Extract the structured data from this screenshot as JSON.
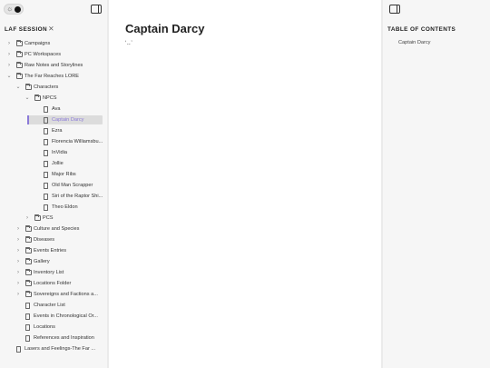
{
  "sidebar": {
    "section_title": "LAF SESSION",
    "tree": [
      {
        "label": "Campaigns",
        "type": "folder",
        "depth": 0,
        "expanded": false
      },
      {
        "label": "PC Workspaces",
        "type": "folder",
        "depth": 0,
        "expanded": false
      },
      {
        "label": "Raw Notes and Storylines",
        "type": "folder",
        "depth": 0,
        "expanded": false
      },
      {
        "label": "The Far Reaches LORE",
        "type": "folder",
        "depth": 0,
        "expanded": true
      },
      {
        "label": "Characters",
        "type": "folder",
        "depth": 1,
        "expanded": true
      },
      {
        "label": "NPCS",
        "type": "folder",
        "depth": 2,
        "expanded": true
      },
      {
        "label": "Ava",
        "type": "file",
        "depth": 3
      },
      {
        "label": "Captain Darcy",
        "type": "file",
        "depth": 3,
        "active": true
      },
      {
        "label": "Ezra",
        "type": "file",
        "depth": 3
      },
      {
        "label": "Florencia Williamsbu...",
        "type": "file",
        "depth": 3
      },
      {
        "label": "InVidia",
        "type": "file",
        "depth": 3
      },
      {
        "label": "Jollie",
        "type": "file",
        "depth": 3
      },
      {
        "label": "Major Ribs",
        "type": "file",
        "depth": 3
      },
      {
        "label": "Old Man Scrapper",
        "type": "file",
        "depth": 3
      },
      {
        "label": "Siri of the Raptor Shi...",
        "type": "file",
        "depth": 3
      },
      {
        "label": "Theo Eldon",
        "type": "file",
        "depth": 3
      },
      {
        "label": "PCS",
        "type": "folder",
        "depth": 2,
        "expanded": false
      },
      {
        "label": "Culture and Species",
        "type": "folder",
        "depth": 1,
        "expanded": false
      },
      {
        "label": "Diseases",
        "type": "folder",
        "depth": 1,
        "expanded": false
      },
      {
        "label": "Events Entries",
        "type": "folder",
        "depth": 1,
        "expanded": false
      },
      {
        "label": "Gallery",
        "type": "folder",
        "depth": 1,
        "expanded": false
      },
      {
        "label": "Inventory List",
        "type": "folder",
        "depth": 1,
        "expanded": false
      },
      {
        "label": "Locations Folder",
        "type": "folder",
        "depth": 1,
        "expanded": false
      },
      {
        "label": "Sovereigns and Factions a...",
        "type": "folder",
        "depth": 1,
        "expanded": false
      },
      {
        "label": "Character List",
        "type": "file",
        "depth": 1
      },
      {
        "label": "Events in Chronological Or...",
        "type": "file",
        "depth": 1
      },
      {
        "label": "Locations",
        "type": "file",
        "depth": 1
      },
      {
        "label": "References and Inspiration",
        "type": "file",
        "depth": 1
      },
      {
        "label": "Lasers and Feelings-The Far ...",
        "type": "file",
        "depth": 0
      }
    ]
  },
  "main": {
    "title": "Captain Darcy",
    "body": "‘‥’"
  },
  "toc": {
    "title": "TABLE OF CONTENTS",
    "items": [
      "Captain Darcy"
    ]
  },
  "colors": {
    "accent": "#8b7ad8",
    "active_bg": "#dcdcdc"
  }
}
